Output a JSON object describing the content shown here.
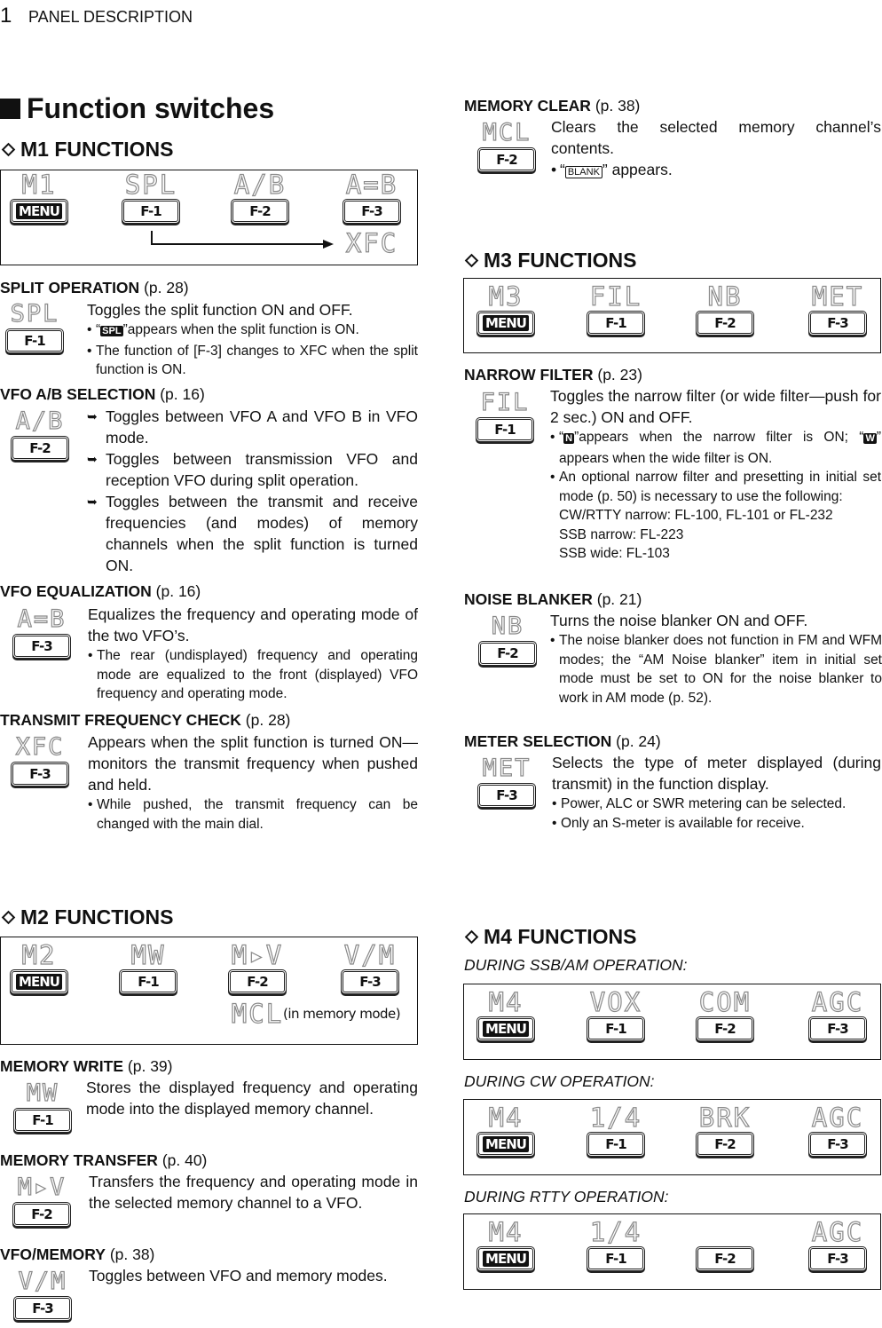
{
  "header": {
    "number": "1",
    "title": "PANEL DESCRIPTION"
  },
  "main_title": "Function switches",
  "keys": {
    "menu": "MENU",
    "f1": "F-1",
    "f2": "F-2",
    "f3": "F-3"
  },
  "m1": {
    "heading": "M1 FUNCTIONS",
    "display": [
      "M1",
      "SPL",
      "A/B",
      "A=B"
    ],
    "alt_f3": "XFC"
  },
  "m2": {
    "heading": "M2 FUNCTIONS",
    "display": [
      "M2",
      "MW",
      "M▸V",
      "V/M"
    ],
    "alt_f2": "MCL",
    "alt_note": "(in memory mode)"
  },
  "m3": {
    "heading": "M3 FUNCTIONS",
    "display": [
      "M3",
      "FIL",
      "NB",
      "MET"
    ]
  },
  "m4": {
    "heading": "M4 FUNCTIONS",
    "modes": [
      {
        "label": "DURING SSB/AM OPERATION:",
        "display": [
          "M4",
          "VOX",
          "COM",
          "AGC"
        ]
      },
      {
        "label": "DURING CW OPERATION:",
        "display": [
          "M4",
          "1/4",
          "BRK",
          "AGC"
        ]
      },
      {
        "label": "DURING RTTY OPERATION:",
        "display": [
          "M4",
          "1/4",
          "",
          "AGC"
        ]
      }
    ]
  },
  "entries": {
    "split": {
      "title": "SPLIT OPERATION",
      "page": "(p. 28)",
      "lcd": "SPL",
      "key": "F-1",
      "main": "Toggles the split function ON and OFF.",
      "b1_pre": "“",
      "b1_badge": "SPL",
      "b1_post": "”appears when the split function is ON.",
      "b2": "The function of [F-3] changes to XFC when the split function is ON."
    },
    "vfoab": {
      "title": "VFO A/B SELECTION",
      "page": "(p. 16)",
      "lcd": "A/B",
      "key": "F-2",
      "a1": "Toggles between VFO A and VFO B in VFO mode.",
      "a2": "Toggles between transmission VFO and reception VFO during split operation.",
      "a3": "Toggles between the transmit and receive frequencies (and modes) of memory channels when the split function is turned ON."
    },
    "vfoeq": {
      "title": "VFO EQUALIZATION",
      "page": "(p. 16)",
      "lcd": "A=B",
      "key": "F-3",
      "main": "Equalizes the frequency and operating mode of the two VFO’s.",
      "b1": "The rear (undisplayed) frequency and operating mode are equalized to the front (displayed) VFO frequency and operating mode."
    },
    "xfc": {
      "title": "TRANSMIT FREQUENCY CHECK",
      "page": "(p. 28)",
      "lcd": "XFC",
      "key": "F-3",
      "main": "Appears when the split function is turned ON—monitors the transmit frequency when pushed and held.",
      "b1": "While pushed, the transmit frequency can be changed with the main dial."
    },
    "mw": {
      "title": "MEMORY WRITE",
      "page": "(p. 39)",
      "lcd": "MW",
      "key": "F-1",
      "main": "Stores the displayed frequency and operating mode into the displayed memory channel."
    },
    "mv": {
      "title": "MEMORY TRANSFER",
      "page": "(p. 40)",
      "lcd": "M▸V",
      "key": "F-2",
      "main": "Transfers the frequency and operating mode in the selected memory channel to a VFO."
    },
    "vm": {
      "title": "VFO/MEMORY",
      "page": "(p. 38)",
      "lcd": "V/M",
      "key": "F-3",
      "main": "Toggles between VFO and memory modes."
    },
    "mcl": {
      "title": "MEMORY CLEAR",
      "page": "(p. 38)",
      "lcd": "MCL",
      "key": "F-2",
      "main": "Clears the selected memory channel’s contents.",
      "b1_pre": "“",
      "b1_badge": "BLANK",
      "b1_post": "” appears."
    },
    "fil": {
      "title": "NARROW FILTER",
      "page": "(p. 23)",
      "lcd": "FIL",
      "key": "F-1",
      "main": "Toggles the narrow filter (or wide filter—push for 2 sec.) ON and OFF.",
      "b1_pre": "“",
      "b1_badge_n": "N",
      "b1_mid": "”appears when the narrow filter is ON; “",
      "b1_badge_w": "W",
      "b1_post": "” appears when the wide filter is ON.",
      "b2": "An optional narrow filter and presetting in initial set mode (p. 50) is necessary to use the following:",
      "l1": "CW/RTTY narrow: FL-100, FL-101 or FL-232",
      "l2": "SSB narrow: FL-223",
      "l3": "SSB wide: FL-103"
    },
    "nb": {
      "title": "NOISE BLANKER",
      "page": "(p. 21)",
      "lcd": "NB",
      "key": "F-2",
      "main": "Turns the noise blanker ON and OFF.",
      "b1": "The noise blanker does not function in FM and WFM modes; the “AM Noise blanker” item in initial set mode must be set to ON for the noise blanker to work in AM mode (p. 52)."
    },
    "met": {
      "title": "METER SELECTION",
      "page": "(p. 24)",
      "lcd": "MET",
      "key": "F-3",
      "main": "Selects the type of meter displayed (during transmit) in the function display.",
      "b1": "Power, ALC or SWR metering can be selected.",
      "b2": "Only an S-meter is available for receive."
    }
  }
}
